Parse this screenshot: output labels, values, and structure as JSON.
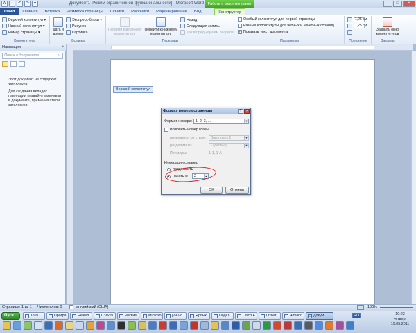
{
  "title": {
    "document": "Документ1 [Режим ограниченной функциональности] - Microsoft Word",
    "context_tab": "Работа с колонтитулами",
    "minimize": "–",
    "maximize": "□",
    "close": "×"
  },
  "tabs": [
    "Файл",
    "Главная",
    "Вставка",
    "Разметка страницы",
    "Ссылки",
    "Рассылки",
    "Рецензирование",
    "Вид",
    "Конструктор"
  ],
  "ribbon": {
    "groups": {
      "headers_footers": {
        "label": "Колонтитулы",
        "items": [
          "Верхний колонтитул ▾",
          "Нижний колонтитул ▾",
          "Номер страницы ▾"
        ]
      },
      "insert": {
        "label": "Вставка",
        "date_time": "Дата и время",
        "items": [
          "Экспресс-блоки ▾",
          "Рисунок",
          "Картинка"
        ]
      },
      "transitions": {
        "label": "Переходы",
        "goto_header": "Перейти к верхнему колонтитулу",
        "goto_footer": "Перейти к нижнему колонтитулу",
        "prev": "Назад",
        "next": "Следующая запись",
        "link_prev": "Как в предыдущем разделе"
      },
      "options": {
        "label": "Параметры",
        "items": [
          {
            "label": "Особый колонтитул для первой страницы",
            "checked": false
          },
          {
            "label": "Разные колонтитулы для четных и нечетных страниц",
            "checked": false
          },
          {
            "label": "Показать текст документа",
            "checked": true
          }
        ]
      },
      "position": {
        "label": "Положение",
        "header_top": "1,25 см",
        "footer_bottom": "1,25 см"
      },
      "close": {
        "label": "Закрыть",
        "button": "Закрыть окно колонтитулов"
      }
    }
  },
  "nav": {
    "title": "Навигация",
    "close": "×",
    "search_placeholder": "Поиск в документе",
    "message_1": "Этот документ не содержит заголовков.",
    "message_2": "Для создания вкладок навигации создайте заголовки в документе, применив стили заголовков."
  },
  "document": {
    "header_tag": "Верхний колонтитул"
  },
  "dialog": {
    "title": "Формат номера страницы",
    "help": "?",
    "close": "×",
    "number_format_label": "Формат номера:",
    "number_format_value": "1, 2, 3, ...",
    "include_chapter_label": "Включить номер главы",
    "include_chapter_checked": false,
    "chapter_style_label": "начинается со стиля:",
    "chapter_style_value": "Заголовок 1",
    "separator_label": "разделитель:",
    "separator_value": "- (дефис)",
    "examples_label": "Примеры:",
    "examples_value": "1-1, 1-А",
    "numbering_label": "Нумерация страниц",
    "continue_label": "продолжить",
    "start_at_label": "начать с:",
    "start_at_value": "2",
    "selected_option": "start_at",
    "ok": "OK",
    "cancel": "Отмена"
  },
  "status": {
    "page": "Страница: 1 из 1",
    "words": "Число слов: 0",
    "language": "английский (США)",
    "zoom": "100%"
  },
  "taskbar": {
    "start": "Пуск",
    "buttons": [
      "Total C...",
      "Програ...",
      "Нежел...",
      "C:\\WIN...",
      "Реквиз...",
      "Microso...",
      "[290-8...",
      "Ярлык ...",
      "Подсл...",
      "Cisco A...",
      "Ответ...",
      "Advanc...",
      "Докум..."
    ],
    "active_index": 12,
    "lang": "RU",
    "time": "10:22",
    "weekday": "четверг",
    "date": "19.05.2011"
  }
}
